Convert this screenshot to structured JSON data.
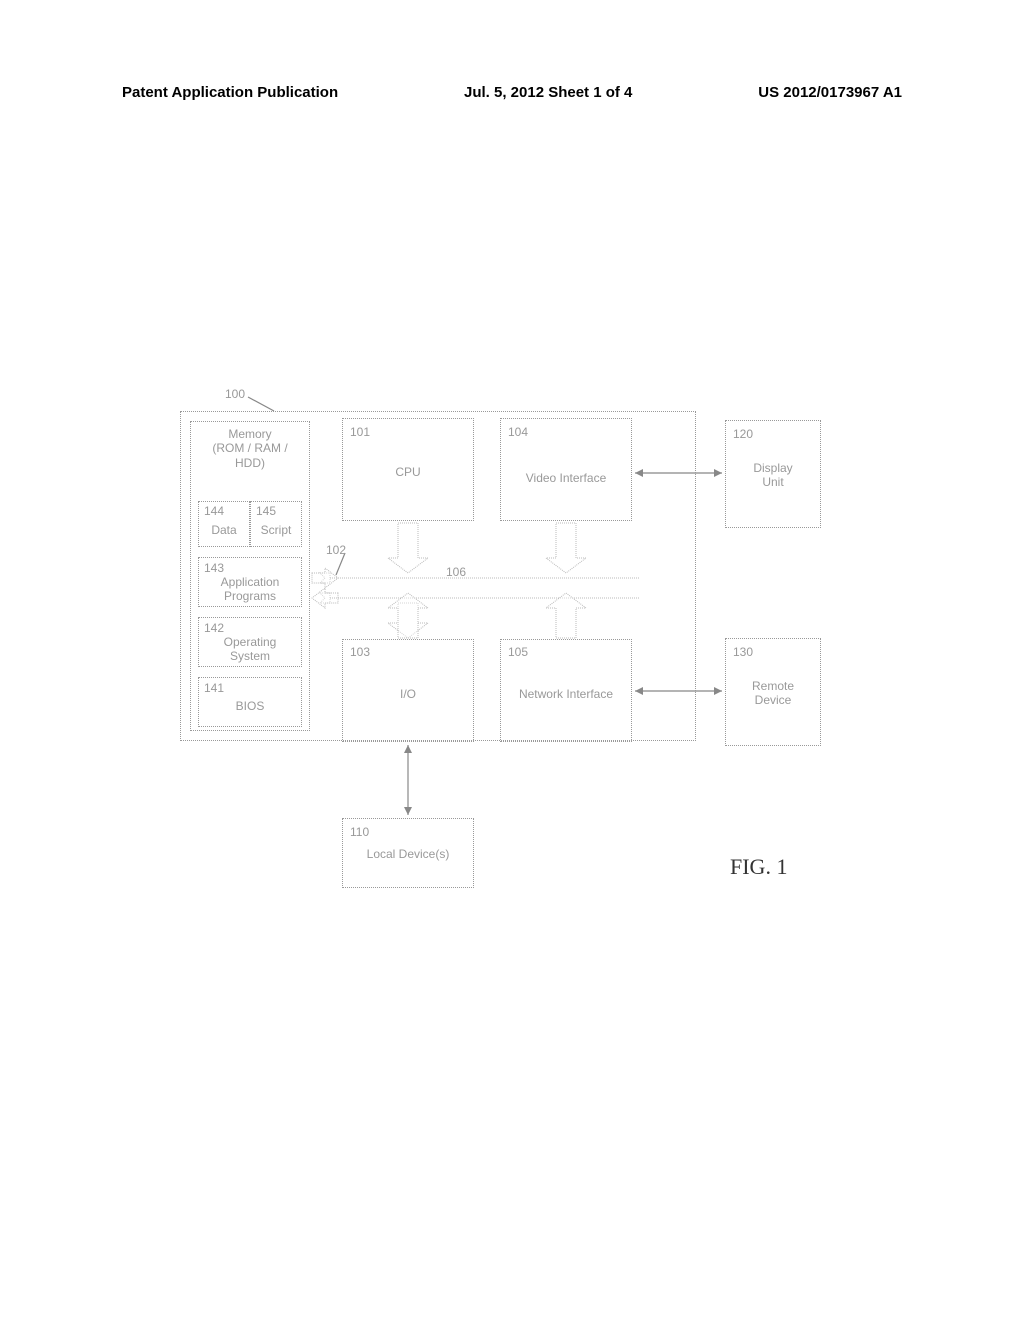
{
  "header": {
    "left": "Patent Application Publication",
    "center": "Jul. 5, 2012   Sheet 1 of 4",
    "right": "US 2012/0173967 A1"
  },
  "refs": {
    "sys": "100",
    "cpu": "101",
    "bus1": "102",
    "io": "103",
    "video": "104",
    "net": "105",
    "bus2": "106",
    "local": "110",
    "display": "120",
    "remote": "130",
    "bios": "141",
    "os": "142",
    "apps": "143",
    "data": "144",
    "script": "145"
  },
  "labels": {
    "memory": "Memory\n(ROM / RAM / HDD)",
    "data": "Data",
    "script": "Script",
    "apps": "Application\nPrograms",
    "os": "Operating\nSystem",
    "bios": "BIOS",
    "cpu": "CPU",
    "video": "Video Interface",
    "display": "Display\nUnit",
    "io": "I/O",
    "net": "Network Interface",
    "remote": "Remote\nDevice",
    "local": "Local Device(s)"
  },
  "figure_caption": "FIG. 1"
}
